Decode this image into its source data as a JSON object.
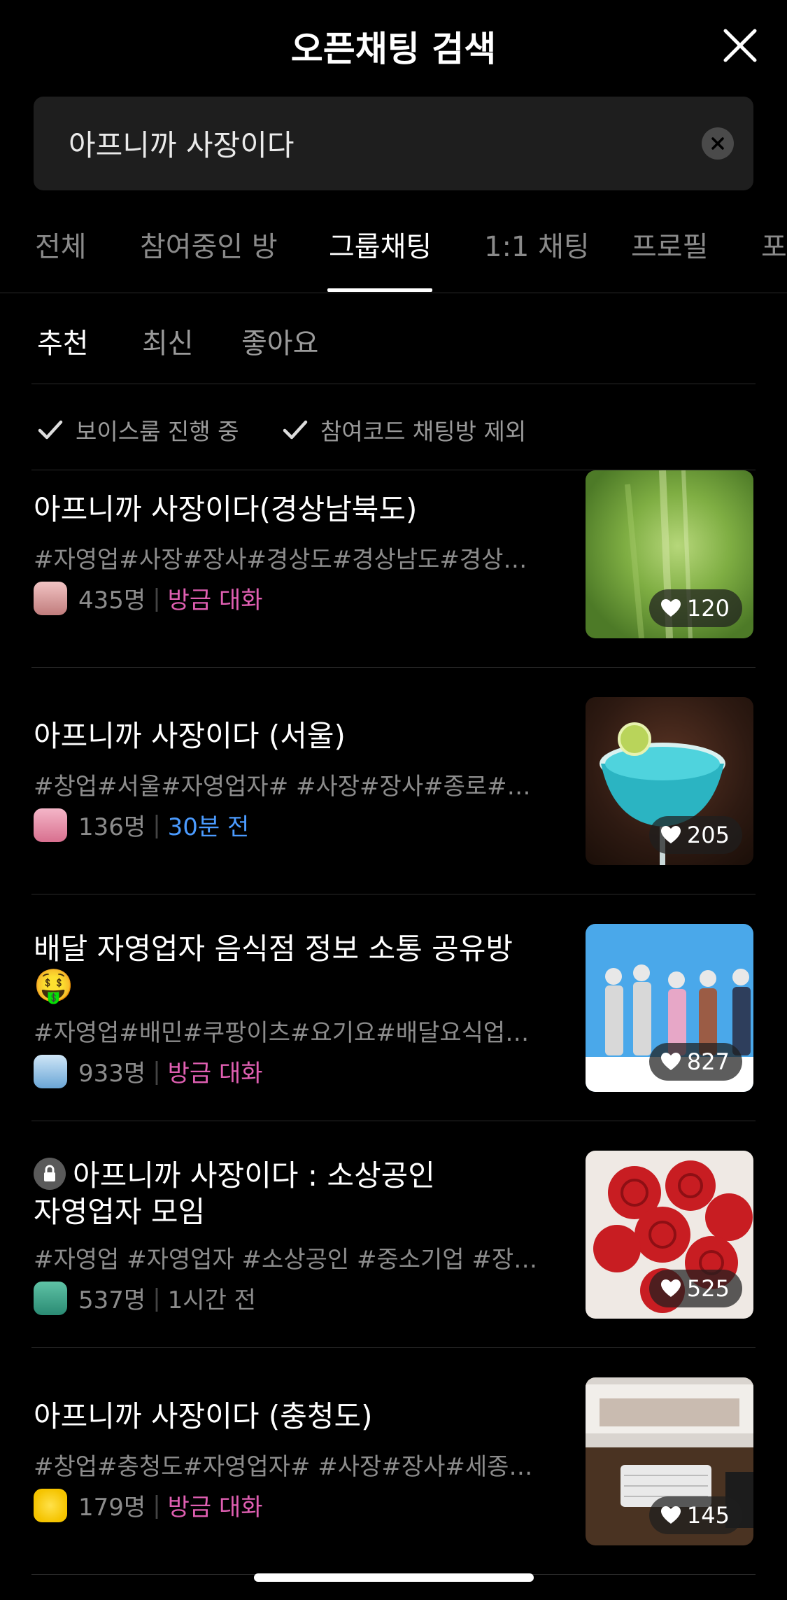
{
  "header": {
    "title": "오픈채팅 검색",
    "close_icon": "close-icon"
  },
  "search": {
    "value": "아프니까 사장이다",
    "clear_icon": "clear-icon"
  },
  "tabs": [
    {
      "label": "전체"
    },
    {
      "label": "참여중인 방"
    },
    {
      "label": "그룹채팅"
    },
    {
      "label": "1:1 채팅"
    },
    {
      "label": "프로필"
    },
    {
      "label": "포"
    }
  ],
  "active_tab": "그룹채팅",
  "sorts": [
    {
      "label": "추천"
    },
    {
      "label": "최신"
    },
    {
      "label": "좋아요"
    }
  ],
  "active_sort": "추천",
  "filters": [
    {
      "label": "보이스룸 진행 중",
      "icon": "check-icon"
    },
    {
      "label": "참여코드 채팅방 제외",
      "icon": "check-icon"
    }
  ],
  "results": [
    {
      "title": "아프니까 사장이다(경상남북도)",
      "tags": "#자영업#사장#장사#경상도#경상남도#경상…",
      "members": "435명",
      "recency": "방금 대화",
      "recency_color": "#e05fb2",
      "likes": "120",
      "locked": false
    },
    {
      "title": "아프니까 사장이다 (서울)",
      "tags": "#창업#서울#자영업자# #사장#장사#종로#…",
      "members": "136명",
      "recency": "30분 전",
      "recency_color": "#4b9bff",
      "likes": "205",
      "locked": false
    },
    {
      "title": "배달 자영업자 음식점 정보 소통 공유방",
      "title_emoji": "🤑",
      "tags": "#자영업#배민#쿠팡이츠#요기요#배달요식업…",
      "members": "933명",
      "recency": "방금 대화",
      "recency_color": "#e05fb2",
      "likes": "827",
      "locked": false
    },
    {
      "title": "아프니까 사장이다 : 소상공인",
      "title_line2": "자영업자 모임",
      "tags": "#자영업 #자영업자 #소상공인 #중소기업 #장…",
      "members": "537명",
      "recency": "1시간 전",
      "recency_color": "#8c8c8c",
      "likes": "525",
      "locked": true
    },
    {
      "title": "아프니까 사장이다 (충청도)",
      "tags": "#창업#충청도#자영업자# #사장#장사#세종…",
      "members": "179명",
      "recency": "방금 대화",
      "recency_color": "#e05fb2",
      "likes": "145",
      "locked": false
    }
  ]
}
